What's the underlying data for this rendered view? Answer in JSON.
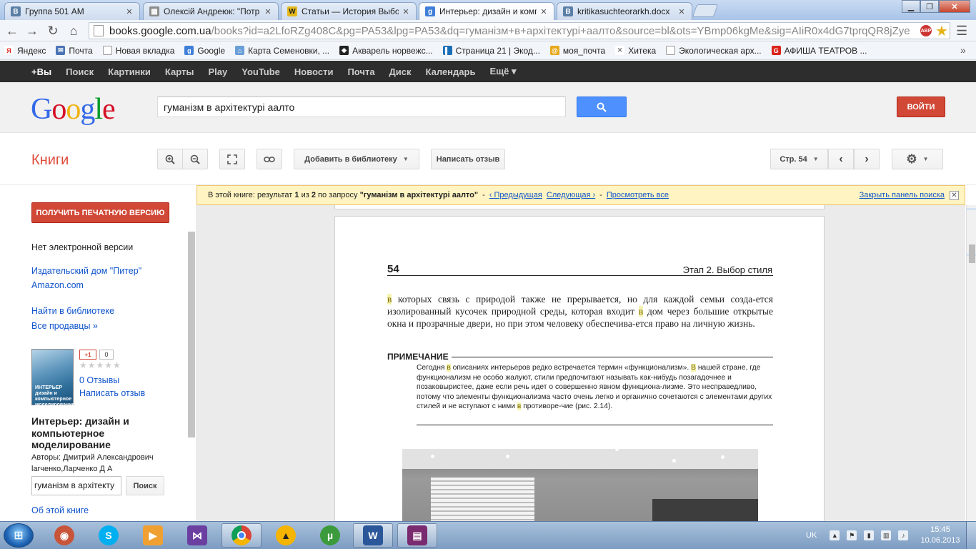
{
  "browser": {
    "tabs": [
      {
        "label": "Группа 501 АМ",
        "icon_letter": "В",
        "icon_color": "#5b7fa6"
      },
      {
        "label": "Олексій Андреюк: \"Потр",
        "icon_letter": "",
        "icon_color": "#8c8c8c"
      },
      {
        "label": "Статьи — История Выбор",
        "icon_letter": "W",
        "icon_color": "#e5b91a"
      },
      {
        "label": "Интерьер: дизайн и комп",
        "icon_letter": "g",
        "icon_color": "#3f7fd8"
      },
      {
        "label": "kritikasuchteorarkh.docx",
        "icon_letter": "В",
        "icon_color": "#5b7fa6"
      }
    ],
    "url_host": "books.google.com.ua",
    "url_path": "/books?id=a2LfoRZg408C&pg=PA53&lpg=PA53&dq=гуманізм+в+архітектурі+аалто&source=bl&ots=YBmp06kgMe&sig=AIiR0x4dG7tprqQR8jZye",
    "abp_label": "ABP",
    "bookmarks": [
      {
        "label": "Яндекс",
        "icon_color": "#e52620",
        "icon_letter": "Я"
      },
      {
        "label": "Почта",
        "icon_color": "#4a74b5",
        "icon_letter": "✉"
      },
      {
        "label": "Новая вкладка",
        "icon_color": "#ffffff",
        "icon_letter": ""
      },
      {
        "label": "Google",
        "icon_color": "#3f7fd8",
        "icon_letter": "g"
      },
      {
        "label": "Карта Семеновки, ...",
        "icon_color": "#6a9fd8",
        "icon_letter": "⌂"
      },
      {
        "label": "Акварель норвежс...",
        "icon_color": "#222222",
        "icon_letter": "◆"
      },
      {
        "label": "Страница 21 | Экод...",
        "icon_color": "#1a6eb5",
        "icon_letter": "▌"
      },
      {
        "label": "моя_почта",
        "icon_color": "#e5a91a",
        "icon_letter": "@"
      },
      {
        "label": "Хитека",
        "icon_color": "#777777",
        "icon_letter": "✕"
      },
      {
        "label": "Экологическая арх...",
        "icon_color": "#ffffff",
        "icon_letter": ""
      },
      {
        "label": "АФИША ТЕАТРОВ ...",
        "icon_color": "#d9261c",
        "icon_letter": "G"
      }
    ]
  },
  "gbar": {
    "items": [
      "+Вы",
      "Поиск",
      "Картинки",
      "Карты",
      "Play",
      "YouTube",
      "Новости",
      "Почта",
      "Диск",
      "Календарь",
      "Ещё ▾"
    ]
  },
  "header": {
    "logo": [
      "G",
      "o",
      "o",
      "g",
      "l",
      "e"
    ],
    "logo_colors": [
      "#3369e8",
      "#d50f25",
      "#eeb211",
      "#3369e8",
      "#009925",
      "#d50f25"
    ],
    "search_value": "гуманізм в архітектурі аалто",
    "login_label": "ВОЙТИ"
  },
  "toolbar": {
    "section_title": "Книги",
    "add_library": "Добавить в библиотеку",
    "write_review": "Написать отзыв",
    "page_select": "Стр. 54"
  },
  "notice": {
    "prefix": "В этой книге: результат",
    "current": "1",
    "of": "из",
    "total": "2",
    "query_prefix": "по запросу",
    "query": "\"гуманізм в архітектурі аалто\"",
    "prev": "‹ Предыдущая",
    "next": "Следующая ›",
    "all": "Просмотреть все",
    "close": "Закрыть панель поиска"
  },
  "sidebar": {
    "print_btn": "ПОЛУЧИТЬ ПЕЧАТНУЮ ВЕРСИЮ",
    "no_ebook": "Нет электронной версии",
    "publisher": "Издательский дом \"Питер\"",
    "amazon": "Amazon.com",
    "library": "Найти в библиотеке",
    "sellers": "Все продавцы »",
    "plus_label": "+1",
    "plus_count": "0",
    "stars": "★★★★★",
    "reviews": "0 Отзывы",
    "write_review": "Написать отзыв",
    "cover_text": "ИНТЕРЬЕР дизайн и компьютерное моделирование",
    "title": "Интерьер: дизайн и компьютерное моделирование",
    "authors": "Авторы: Дмитрий Александрович larченко,Ларченко Д А",
    "search_value": "гуманізм в архітекту",
    "search_btn": "Поиск",
    "about": "Об этой книге"
  },
  "page": {
    "number": "54",
    "chapter": "Этап 2. Выбор стиля",
    "body_hl1": "в",
    "body_part1": " которых связь с природой также не прерывается, но для каждой семьи созда-ется изолированный кусочек природной среды, которая входит ",
    "body_hl2": "в",
    "body_part2": " дом через большие открытые окна и прозрачные двери, но при этом человеку обеспечива-ется право на личную жизнь.",
    "note_title": "ПРИМЕЧАНИЕ",
    "note_p1": "Сегодня ",
    "note_hl1": "в",
    "note_p2": " описаниях интерьеров редко встречается термин «функционализм». ",
    "note_hl2": "В",
    "note_p3": " нашей стране, где функционализм не особо жалуют, стили предпочитают называть как-нибудь позагадочнее и позаковыристее, даже если речь идет о совершенно явном функциона-лизме. Это несправедливо, потому что элементы функционализма часто очень легко и органично сочетаются с элементами других стилей и не вступают с ними ",
    "note_hl3": "в",
    "note_p4": " противоре-чие (рис. 2.14)."
  },
  "taskbar": {
    "lang": "UK",
    "time": "15:45",
    "date": "10.06.2013"
  }
}
